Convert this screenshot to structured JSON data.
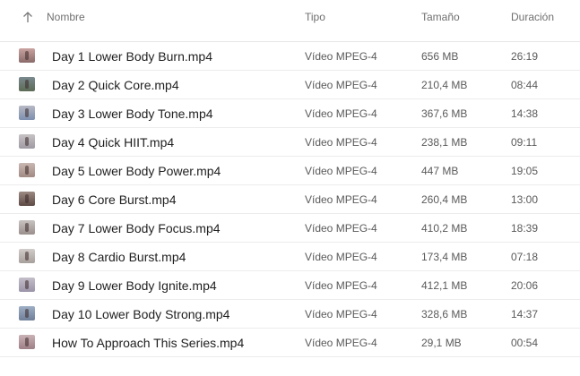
{
  "columns": {
    "name": "Nombre",
    "type": "Tipo",
    "size": "Tamaño",
    "duration": "Duración"
  },
  "sort_icon": "arrow-up-icon",
  "files": [
    {
      "name": "Day 1 Lower Body Burn.mp4",
      "type": "Vídeo MPEG-4",
      "size": "656 MB",
      "duration": "26:19",
      "thumb_colors": [
        "#c9a3a0",
        "#8a6b6a"
      ]
    },
    {
      "name": "Day 2 Quick Core.mp4",
      "type": "Vídeo MPEG-4",
      "size": "210,4 MB",
      "duration": "08:44",
      "thumb_colors": [
        "#7b8a8f",
        "#5c6a55"
      ]
    },
    {
      "name": "Day 3 Lower Body Tone.mp4",
      "type": "Vídeo MPEG-4",
      "size": "367,6 MB",
      "duration": "14:38",
      "thumb_colors": [
        "#b7b9c4",
        "#7d8fb0"
      ]
    },
    {
      "name": "Day 4 Quick HIIT.mp4",
      "type": "Vídeo MPEG-4",
      "size": "238,1 MB",
      "duration": "09:11",
      "thumb_colors": [
        "#c6c2c4",
        "#9f9aa3"
      ]
    },
    {
      "name": "Day 5 Lower Body Power.mp4",
      "type": "Vídeo MPEG-4",
      "size": "447 MB",
      "duration": "19:05",
      "thumb_colors": [
        "#c9b7b2",
        "#a28a84"
      ]
    },
    {
      "name": "Day 6 Core Burst.mp4",
      "type": "Vídeo MPEG-4",
      "size": "260,4 MB",
      "duration": "13:00",
      "thumb_colors": [
        "#9b8a83",
        "#5e4a44"
      ]
    },
    {
      "name": "Day 7 Lower Body Focus.mp4",
      "type": "Vídeo MPEG-4",
      "size": "410,2 MB",
      "duration": "18:39",
      "thumb_colors": [
        "#c7c2c0",
        "#9a8f8c"
      ]
    },
    {
      "name": "Day 8 Cardio Burst.mp4",
      "type": "Vídeo MPEG-4",
      "size": "173,4 MB",
      "duration": "07:18",
      "thumb_colors": [
        "#d2cdca",
        "#a79f9b"
      ]
    },
    {
      "name": "Day 9 Lower Body Ignite.mp4",
      "type": "Vídeo MPEG-4",
      "size": "412,1 MB",
      "duration": "20:06",
      "thumb_colors": [
        "#c4bfc9",
        "#9b93a8"
      ]
    },
    {
      "name": "Day 10 Lower Body Strong.mp4",
      "type": "Vídeo MPEG-4",
      "size": "328,6 MB",
      "duration": "14:37",
      "thumb_colors": [
        "#9eaec4",
        "#6f7f98"
      ]
    },
    {
      "name": "How To Approach This Series.mp4",
      "type": "Vídeo MPEG-4",
      "size": "29,1 MB",
      "duration": "00:54",
      "thumb_colors": [
        "#c9b2b6",
        "#9e7f86"
      ]
    }
  ]
}
